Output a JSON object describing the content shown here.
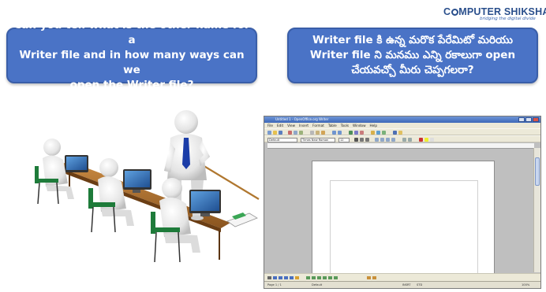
{
  "logo": {
    "text_before": "C",
    "text_after": "MPUTER SHIKSHA",
    "tagline": "bridging the digital divide"
  },
  "question_english": {
    "line1": "Can you tell what is the other name for a",
    "line2": "Writer file and in how many ways can we",
    "line3": "open the Writer file?"
  },
  "question_telugu": {
    "line1": "Writer file కి ఉన్న మరొక పేరేమిటో మరియు",
    "line2": "Writer file ని మనము ఎన్ని రకాలుగా open",
    "line3": "చేయవచ్చో మీరు చెప్పగలరా?"
  },
  "screenshot": {
    "window_title": "Untitled 1 - OpenOffice.org Writer",
    "menu": [
      "File",
      "Edit",
      "View",
      "Insert",
      "Format",
      "Table",
      "Tools",
      "Window",
      "Help"
    ],
    "style_box": "Default",
    "font_box": "Times New Roman",
    "size_box": "12",
    "status": {
      "page": "Page 1 / 1",
      "style": "Default",
      "mode": "INSRT",
      "std": "STD",
      "zoom": "100%"
    }
  },
  "colors": {
    "bubble_fill": "#4a73c6",
    "bubble_border": "#3a5ea8",
    "logo_text": "#2a4f8c",
    "tie": "#1b3da8",
    "chair": "#1e7b3a",
    "monitor_screen": "#2f6fb7"
  }
}
